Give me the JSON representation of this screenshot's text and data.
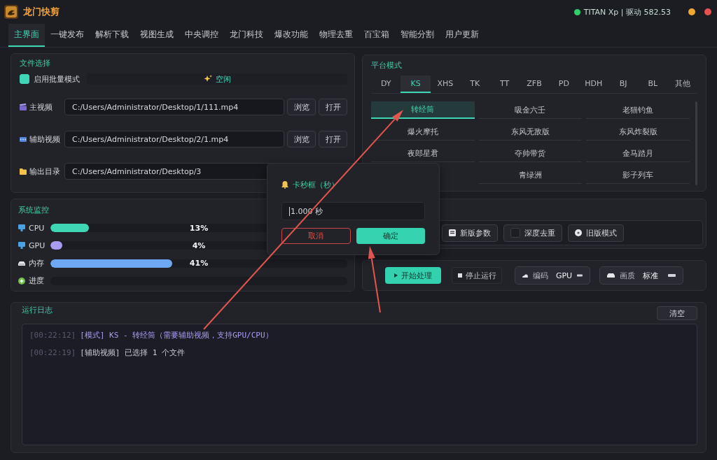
{
  "app": {
    "title": "龙门快剪",
    "gpu_status": "TITAN Xp | 驱动 582.53"
  },
  "tabs": [
    {
      "label": "主界面",
      "selected": true
    },
    {
      "label": "一键发布",
      "selected": false
    },
    {
      "label": "解析下载",
      "selected": false
    },
    {
      "label": "视图生成",
      "selected": false
    },
    {
      "label": "中央调控",
      "selected": false
    },
    {
      "label": "龙门科技",
      "selected": false
    },
    {
      "label": "爆改功能",
      "selected": false
    },
    {
      "label": "物理去重",
      "selected": false
    },
    {
      "label": "百宝箱",
      "selected": false
    },
    {
      "label": "智能分割",
      "selected": false
    },
    {
      "label": "用户更新",
      "selected": false
    }
  ],
  "file_panel": {
    "title": "文件选择",
    "batch_mode": {
      "label": "启用批量模式",
      "checked": true
    },
    "status": "空闲",
    "rows": [
      {
        "kind": "main_video",
        "label": "主视频",
        "value": "C:/Users/Administrator/Desktop/1/111.mp4",
        "buttons": [
          "浏览",
          "打开"
        ]
      },
      {
        "kind": "aux_video",
        "label": "辅助视频",
        "value": "C:/Users/Administrator/Desktop/2/1.mp4",
        "buttons": [
          "浏览",
          "打开"
        ]
      },
      {
        "kind": "folder",
        "label": "输出目录",
        "value": "C:/Users/Administrator/Desktop/3"
      }
    ]
  },
  "monitor": {
    "title": "系统监控",
    "meters": [
      {
        "kind": "cpu",
        "label": "CPU",
        "level": 0.13,
        "reading": "13%",
        "color": "#3ed6b5"
      },
      {
        "kind": "gpu",
        "label": "GPU",
        "level": 0.04,
        "reading": "4%",
        "color": "#a99cf0"
      },
      {
        "kind": "memory",
        "label": "内存",
        "level": 0.41,
        "reading": "41%",
        "color": "#6ea8f2"
      },
      {
        "kind": "progress",
        "label": "进度"
      }
    ]
  },
  "platform_panel": {
    "title": "平台模式",
    "platforms": [
      {
        "label": "DY",
        "selected": false
      },
      {
        "label": "KS",
        "selected": true
      },
      {
        "label": "XHS",
        "selected": false
      },
      {
        "label": "TK",
        "selected": false
      },
      {
        "label": "TT",
        "selected": false
      },
      {
        "label": "ZFB",
        "selected": false
      },
      {
        "label": "PD",
        "selected": false
      },
      {
        "label": "HDH",
        "selected": false
      },
      {
        "label": "BJ",
        "selected": false
      },
      {
        "label": "BL",
        "selected": false
      },
      {
        "label": "其他",
        "selected": false
      }
    ],
    "mode_rows": [
      [
        {
          "label": "转经筒",
          "selected": true
        },
        {
          "label": "吸金六壬",
          "selected": false
        },
        {
          "label": "老猫钓鱼",
          "selected": false
        }
      ],
      [
        {
          "label": "爆火摩托",
          "selected": false
        },
        {
          "label": "东风无敌版",
          "selected": false
        },
        {
          "label": "东风炸裂版",
          "selected": false
        }
      ],
      [
        {
          "label": "夜郎星君",
          "selected": false
        },
        {
          "label": "夺帅带货",
          "selected": false
        },
        {
          "label": "金马踏月",
          "selected": false
        }
      ],
      [
        {
          "label": "青绿洲",
          "selected": false
        },
        {
          "label": "影子列车",
          "selected": false
        }
      ]
    ]
  },
  "options": [
    {
      "kind": "button",
      "label": "新版参数"
    },
    {
      "kind": "checkbox",
      "label": "深度去重",
      "checked": false
    },
    {
      "kind": "button",
      "label": "旧版模式"
    }
  ],
  "controls": {
    "start": "开始处理",
    "stop": "停止运行",
    "selects": [
      {
        "label": "编码",
        "value": "GPU"
      },
      {
        "label": "画质",
        "value": "标准"
      }
    ]
  },
  "log": {
    "title": "运行日志",
    "clear": "清空",
    "lines": [
      {
        "time": "[00:22:12]",
        "message": "[模式] KS - 转经筒（需要辅助视频，支持GPU/CPU）",
        "color": "#a99cf2"
      },
      {
        "time": "[00:22:19]",
        "message": "[辅助视频] 已选择 1 个文件",
        "color": "#c9cad2"
      }
    ]
  },
  "dialog": {
    "title": "卡秒框（秒）",
    "value": "1.000 秒",
    "cancel": "取消",
    "confirm": "确定"
  }
}
